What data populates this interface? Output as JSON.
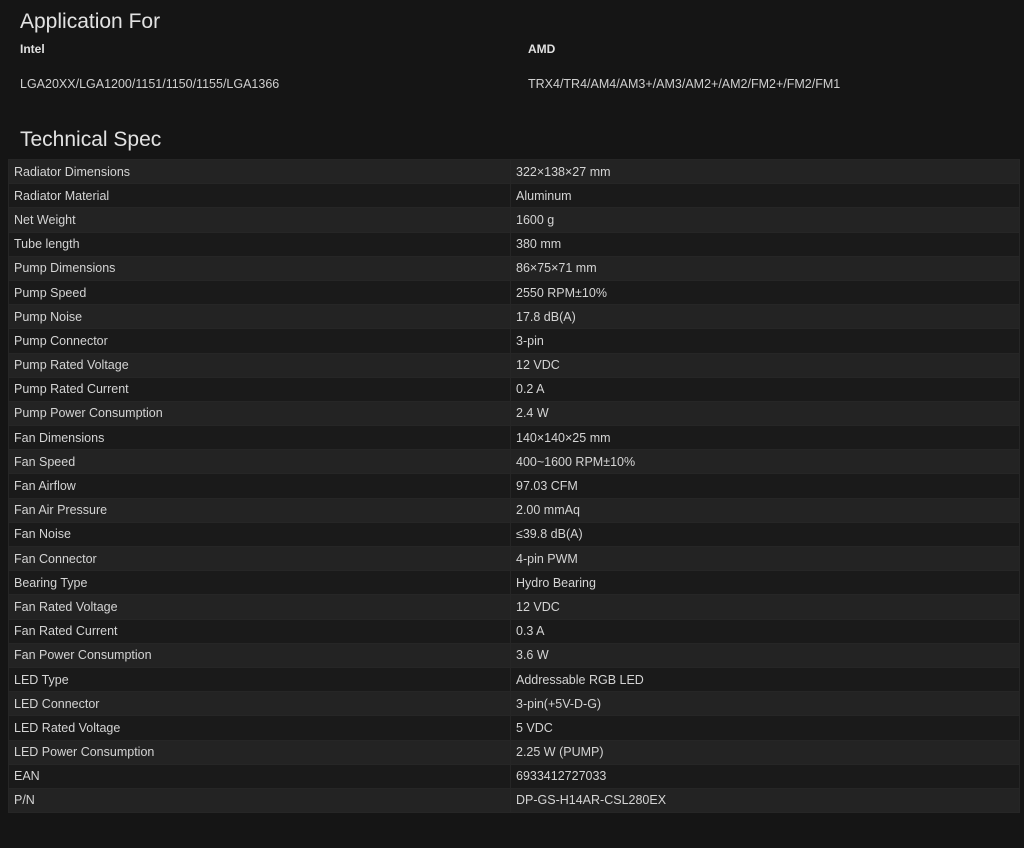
{
  "application": {
    "title": "Application For",
    "intel": {
      "heading": "Intel",
      "sockets": "LGA20XX/LGA1200/1151/1150/1155/LGA1366"
    },
    "amd": {
      "heading": "AMD",
      "sockets": "TRX4/TR4/AM4/AM3+/AM3/AM2+/AM2/FM2+/FM2/FM1"
    }
  },
  "spec": {
    "title": "Technical Spec",
    "rows": [
      {
        "key": "Radiator Dimensions",
        "value": "322×138×27 mm"
      },
      {
        "key": "Radiator Material",
        "value": "Aluminum"
      },
      {
        "key": "Net Weight",
        "value": "1600 g"
      },
      {
        "key": "Tube length",
        "value": "380 mm"
      },
      {
        "key": "Pump Dimensions",
        "value": "86×75×71 mm"
      },
      {
        "key": "Pump Speed",
        "value": "2550 RPM±10%"
      },
      {
        "key": "Pump Noise",
        "value": "17.8 dB(A)"
      },
      {
        "key": "Pump Connector",
        "value": "3-pin"
      },
      {
        "key": "Pump Rated Voltage",
        "value": "12 VDC"
      },
      {
        "key": "Pump Rated Current",
        "value": "0.2 A"
      },
      {
        "key": "Pump Power Consumption",
        "value": "2.4 W"
      },
      {
        "key": "Fan Dimensions",
        "value": "140×140×25 mm"
      },
      {
        "key": "Fan Speed",
        "value": "400~1600 RPM±10%"
      },
      {
        "key": "Fan Airflow",
        "value": "97.03 CFM"
      },
      {
        "key": "Fan Air Pressure",
        "value": "2.00 mmAq"
      },
      {
        "key": "Fan Noise",
        "value": "≤39.8 dB(A)"
      },
      {
        "key": "Fan Connector",
        "value": "4-pin PWM"
      },
      {
        "key": "Bearing Type",
        "value": "Hydro Bearing"
      },
      {
        "key": "Fan Rated Voltage",
        "value": "12 VDC"
      },
      {
        "key": "Fan Rated Current",
        "value": "0.3 A"
      },
      {
        "key": "Fan Power Consumption",
        "value": "3.6 W"
      },
      {
        "key": "LED Type",
        "value": "Addressable RGB LED"
      },
      {
        "key": "LED Connector",
        "value": "3-pin(+5V-D-G)"
      },
      {
        "key": "LED Rated Voltage",
        "value": "5 VDC"
      },
      {
        "key": "LED Power Consumption",
        "value": "2.25 W  (PUMP)"
      },
      {
        "key": "EAN",
        "value": "6933412727033"
      },
      {
        "key": "P/N",
        "value": "DP-GS-H14AR-CSL280EX"
      }
    ]
  }
}
